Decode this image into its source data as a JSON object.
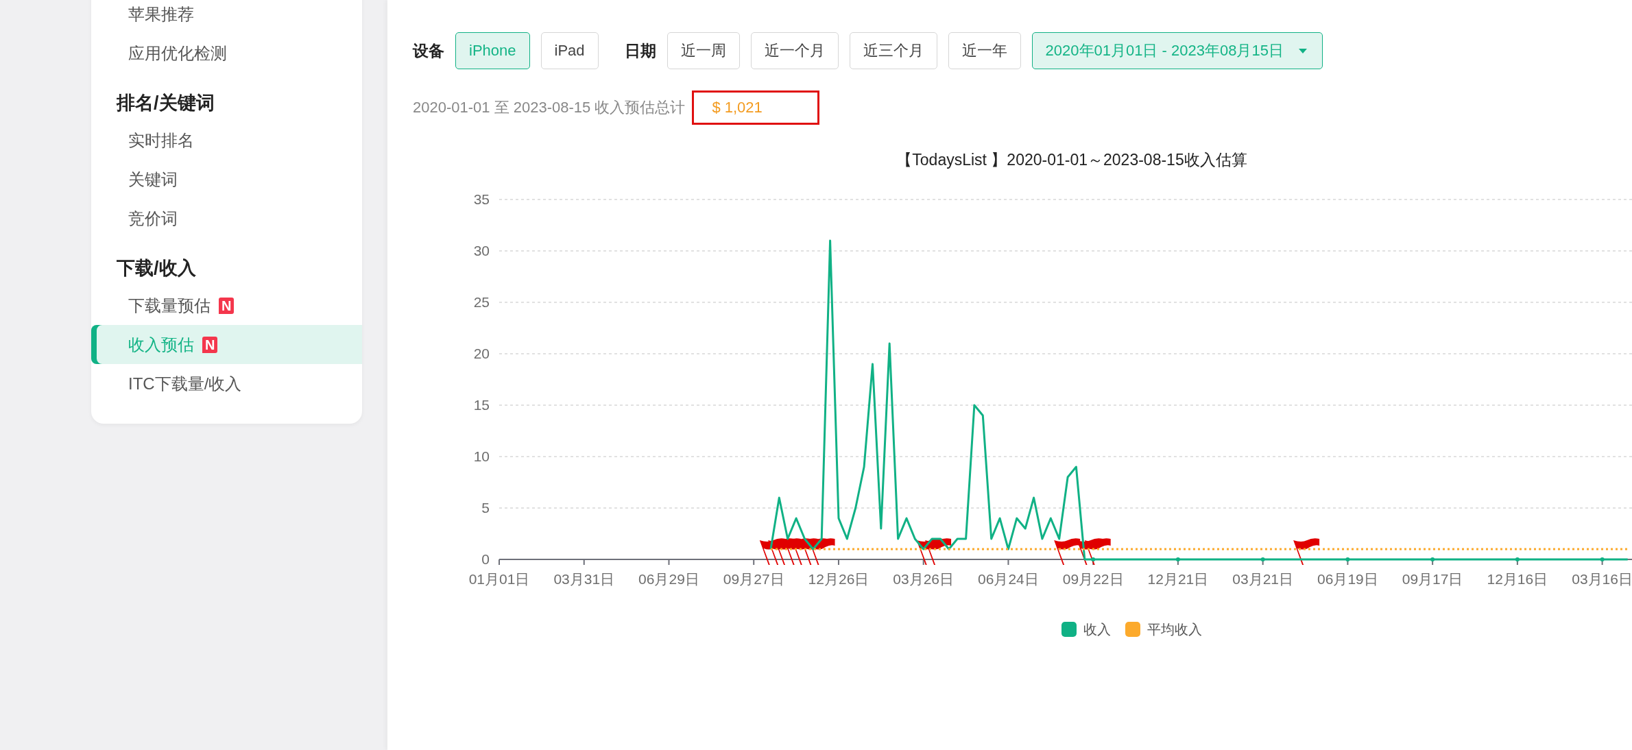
{
  "sidebar": {
    "groups": [
      {
        "items": [
          {
            "label": "苹果推荐",
            "selected": false
          },
          {
            "label": "应用优化检测",
            "selected": false
          }
        ]
      },
      {
        "title": "排名/关键词",
        "items": [
          {
            "label": "实时排名",
            "selected": false
          },
          {
            "label": "关键词",
            "selected": false
          },
          {
            "label": "竞价词",
            "selected": false
          }
        ]
      },
      {
        "title": "下载/收入",
        "items": [
          {
            "label": "下载量预估",
            "selected": false,
            "badge": "N"
          },
          {
            "label": "收入预估",
            "selected": true,
            "badge": "N"
          },
          {
            "label": "ITC下载量/收入",
            "selected": false
          }
        ]
      }
    ]
  },
  "filters": {
    "device_label": "设备",
    "devices": [
      {
        "label": "iPhone",
        "selected": true
      },
      {
        "label": "iPad",
        "selected": false
      }
    ],
    "date_label": "日期",
    "presets": [
      {
        "label": "近一周",
        "selected": false
      },
      {
        "label": "近一个月",
        "selected": false
      },
      {
        "label": "近三个月",
        "selected": false
      },
      {
        "label": "近一年",
        "selected": false
      }
    ],
    "date_range": {
      "value": "2020年01月01日 - 2023年08月15日",
      "active": true
    }
  },
  "summary": {
    "text": "2020-01-01 至 2023-08-15 收入预估总计",
    "total": "$ 1,021",
    "outlined": true
  },
  "chart_data": {
    "type": "line",
    "title": "【TodaysList 】2020-01-01～2023-08-15收入估算",
    "categories": [
      "01月01日",
      null,
      null,
      null,
      null,
      null,
      null,
      null,
      null,
      null,
      "03月31日",
      null,
      null,
      null,
      null,
      null,
      null,
      null,
      null,
      null,
      "06月29日",
      null,
      null,
      null,
      null,
      null,
      null,
      null,
      null,
      null,
      "09月27日",
      null,
      null,
      null,
      null,
      null,
      null,
      null,
      null,
      null,
      "12月26日",
      null,
      null,
      null,
      null,
      null,
      null,
      null,
      null,
      null,
      "03月26日",
      null,
      null,
      null,
      null,
      null,
      null,
      null,
      null,
      null,
      "06月24日",
      null,
      null,
      null,
      null,
      null,
      null,
      null,
      null,
      null,
      "09月22日",
      null,
      null,
      null,
      null,
      null,
      null,
      null,
      null,
      null,
      "12月21日",
      null,
      null,
      null,
      null,
      null,
      null,
      null,
      null,
      null,
      "03月21日",
      null,
      null,
      null,
      null,
      null,
      null,
      null,
      null,
      null,
      "06月19日",
      null,
      null,
      null,
      null,
      null,
      null,
      null,
      null,
      null,
      "09月17日",
      null,
      null,
      null,
      null,
      null,
      null,
      null,
      null,
      null,
      "12月16日",
      null,
      null,
      null,
      null,
      null,
      null,
      null,
      null,
      null,
      "03月16日",
      null,
      null,
      null
    ],
    "series": [
      {
        "name": "收入",
        "color": "#10b185",
        "line_style": "solid",
        "values": [
          null,
          null,
          null,
          null,
          null,
          null,
          null,
          null,
          null,
          null,
          null,
          null,
          null,
          null,
          null,
          null,
          null,
          null,
          null,
          null,
          null,
          null,
          null,
          null,
          null,
          null,
          null,
          null,
          null,
          null,
          null,
          null,
          1,
          6,
          2,
          4,
          2,
          1,
          2,
          31,
          4,
          2,
          5,
          9,
          19,
          3,
          21,
          2,
          4,
          2,
          1,
          2,
          2,
          1,
          2,
          2,
          15,
          14,
          2,
          4,
          1,
          4,
          3,
          6,
          2,
          4,
          2,
          8,
          9,
          0,
          0,
          0,
          0,
          0,
          0,
          0,
          0,
          0,
          0,
          0,
          0,
          0,
          0,
          0,
          0,
          0,
          0,
          0,
          0,
          0,
          0,
          0,
          0,
          0,
          0,
          0,
          0,
          0,
          0,
          0,
          0,
          0,
          0,
          0,
          0,
          0,
          0,
          0,
          0,
          0,
          0,
          0,
          0,
          0,
          0,
          0,
          0,
          0,
          0,
          0,
          0,
          0,
          0,
          0,
          0,
          0,
          0,
          0,
          0,
          0,
          0,
          0,
          0,
          0
        ]
      },
      {
        "name": "平均收入",
        "color": "#fcaa2c",
        "line_style": "dotted",
        "values": [
          null,
          null,
          null,
          null,
          null,
          null,
          null,
          null,
          null,
          null,
          null,
          null,
          null,
          null,
          null,
          null,
          null,
          null,
          null,
          null,
          null,
          null,
          null,
          null,
          null,
          null,
          null,
          null,
          null,
          null,
          null,
          null,
          1,
          1,
          1,
          1,
          1,
          1,
          1,
          1,
          1,
          1,
          1,
          1,
          1,
          1,
          1,
          1,
          1,
          1,
          1,
          1,
          1,
          1,
          1,
          1,
          1,
          1,
          1,
          1,
          1,
          1,
          1,
          1,
          1,
          1,
          1,
          1,
          1,
          1,
          1,
          1,
          1,
          1,
          1,
          1,
          1,
          1,
          1,
          1,
          1,
          1,
          1,
          1,
          1,
          1,
          1,
          1,
          1,
          1,
          1,
          1,
          1,
          1,
          1,
          1,
          1,
          1,
          1,
          1,
          1,
          1,
          1,
          1,
          1,
          1,
          1,
          1,
          1,
          1,
          1,
          1,
          1,
          1,
          1,
          1,
          1,
          1,
          1,
          1,
          1,
          1,
          1,
          1,
          1,
          1,
          1,
          1,
          1,
          1,
          1,
          1,
          1,
          1
        ]
      }
    ],
    "ylim": [
      0,
      35
    ],
    "yticks": [
      0,
      5,
      10,
      15,
      20,
      25,
      30,
      35
    ],
    "grid": true,
    "legend": true
  }
}
